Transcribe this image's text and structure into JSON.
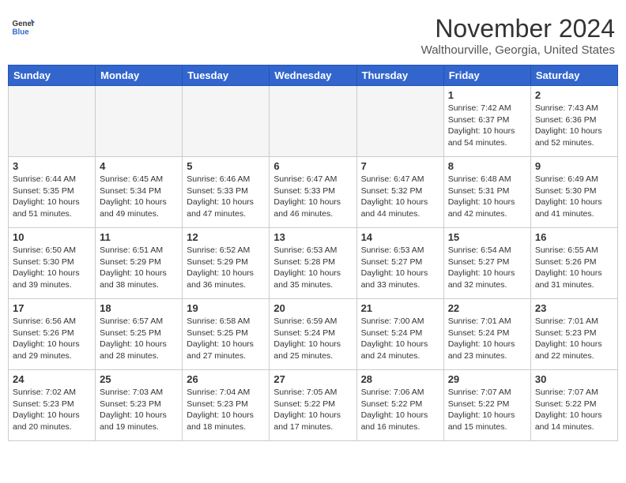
{
  "header": {
    "logo_general": "General",
    "logo_blue": "Blue",
    "month_title": "November 2024",
    "location": "Walthourville, Georgia, United States"
  },
  "days_of_week": [
    "Sunday",
    "Monday",
    "Tuesday",
    "Wednesday",
    "Thursday",
    "Friday",
    "Saturday"
  ],
  "weeks": [
    [
      {
        "day": "",
        "info": ""
      },
      {
        "day": "",
        "info": ""
      },
      {
        "day": "",
        "info": ""
      },
      {
        "day": "",
        "info": ""
      },
      {
        "day": "",
        "info": ""
      },
      {
        "day": "1",
        "info": "Sunrise: 7:42 AM\nSunset: 6:37 PM\nDaylight: 10 hours and 54 minutes."
      },
      {
        "day": "2",
        "info": "Sunrise: 7:43 AM\nSunset: 6:36 PM\nDaylight: 10 hours and 52 minutes."
      }
    ],
    [
      {
        "day": "3",
        "info": "Sunrise: 6:44 AM\nSunset: 5:35 PM\nDaylight: 10 hours and 51 minutes."
      },
      {
        "day": "4",
        "info": "Sunrise: 6:45 AM\nSunset: 5:34 PM\nDaylight: 10 hours and 49 minutes."
      },
      {
        "day": "5",
        "info": "Sunrise: 6:46 AM\nSunset: 5:33 PM\nDaylight: 10 hours and 47 minutes."
      },
      {
        "day": "6",
        "info": "Sunrise: 6:47 AM\nSunset: 5:33 PM\nDaylight: 10 hours and 46 minutes."
      },
      {
        "day": "7",
        "info": "Sunrise: 6:47 AM\nSunset: 5:32 PM\nDaylight: 10 hours and 44 minutes."
      },
      {
        "day": "8",
        "info": "Sunrise: 6:48 AM\nSunset: 5:31 PM\nDaylight: 10 hours and 42 minutes."
      },
      {
        "day": "9",
        "info": "Sunrise: 6:49 AM\nSunset: 5:30 PM\nDaylight: 10 hours and 41 minutes."
      }
    ],
    [
      {
        "day": "10",
        "info": "Sunrise: 6:50 AM\nSunset: 5:30 PM\nDaylight: 10 hours and 39 minutes."
      },
      {
        "day": "11",
        "info": "Sunrise: 6:51 AM\nSunset: 5:29 PM\nDaylight: 10 hours and 38 minutes."
      },
      {
        "day": "12",
        "info": "Sunrise: 6:52 AM\nSunset: 5:29 PM\nDaylight: 10 hours and 36 minutes."
      },
      {
        "day": "13",
        "info": "Sunrise: 6:53 AM\nSunset: 5:28 PM\nDaylight: 10 hours and 35 minutes."
      },
      {
        "day": "14",
        "info": "Sunrise: 6:53 AM\nSunset: 5:27 PM\nDaylight: 10 hours and 33 minutes."
      },
      {
        "day": "15",
        "info": "Sunrise: 6:54 AM\nSunset: 5:27 PM\nDaylight: 10 hours and 32 minutes."
      },
      {
        "day": "16",
        "info": "Sunrise: 6:55 AM\nSunset: 5:26 PM\nDaylight: 10 hours and 31 minutes."
      }
    ],
    [
      {
        "day": "17",
        "info": "Sunrise: 6:56 AM\nSunset: 5:26 PM\nDaylight: 10 hours and 29 minutes."
      },
      {
        "day": "18",
        "info": "Sunrise: 6:57 AM\nSunset: 5:25 PM\nDaylight: 10 hours and 28 minutes."
      },
      {
        "day": "19",
        "info": "Sunrise: 6:58 AM\nSunset: 5:25 PM\nDaylight: 10 hours and 27 minutes."
      },
      {
        "day": "20",
        "info": "Sunrise: 6:59 AM\nSunset: 5:24 PM\nDaylight: 10 hours and 25 minutes."
      },
      {
        "day": "21",
        "info": "Sunrise: 7:00 AM\nSunset: 5:24 PM\nDaylight: 10 hours and 24 minutes."
      },
      {
        "day": "22",
        "info": "Sunrise: 7:01 AM\nSunset: 5:24 PM\nDaylight: 10 hours and 23 minutes."
      },
      {
        "day": "23",
        "info": "Sunrise: 7:01 AM\nSunset: 5:23 PM\nDaylight: 10 hours and 22 minutes."
      }
    ],
    [
      {
        "day": "24",
        "info": "Sunrise: 7:02 AM\nSunset: 5:23 PM\nDaylight: 10 hours and 20 minutes."
      },
      {
        "day": "25",
        "info": "Sunrise: 7:03 AM\nSunset: 5:23 PM\nDaylight: 10 hours and 19 minutes."
      },
      {
        "day": "26",
        "info": "Sunrise: 7:04 AM\nSunset: 5:23 PM\nDaylight: 10 hours and 18 minutes."
      },
      {
        "day": "27",
        "info": "Sunrise: 7:05 AM\nSunset: 5:22 PM\nDaylight: 10 hours and 17 minutes."
      },
      {
        "day": "28",
        "info": "Sunrise: 7:06 AM\nSunset: 5:22 PM\nDaylight: 10 hours and 16 minutes."
      },
      {
        "day": "29",
        "info": "Sunrise: 7:07 AM\nSunset: 5:22 PM\nDaylight: 10 hours and 15 minutes."
      },
      {
        "day": "30",
        "info": "Sunrise: 7:07 AM\nSunset: 5:22 PM\nDaylight: 10 hours and 14 minutes."
      }
    ]
  ]
}
